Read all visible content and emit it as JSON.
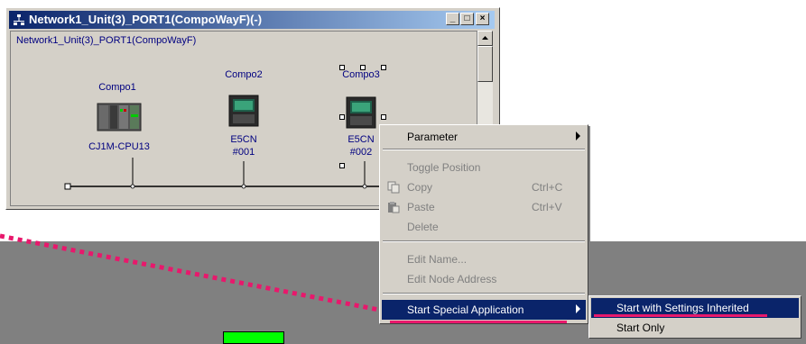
{
  "window": {
    "title": "Network1_Unit(3)_PORT1(CompoWayF)(-)",
    "network_label": "Network1_Unit(3)_PORT1(CompoWayF)",
    "min_glyph": "_",
    "max_glyph": "□",
    "close_glyph": "×"
  },
  "nodes": [
    {
      "name": "Compo1",
      "model": "CJ1M-CPU13",
      "address": ""
    },
    {
      "name": "Compo2",
      "model": "E5CN",
      "address": "#001"
    },
    {
      "name": "Compo3",
      "model": "E5CN",
      "address": "#002"
    }
  ],
  "context_menu": {
    "items": [
      {
        "label": "Parameter",
        "shortcut": "",
        "enabled": true,
        "submenu": true
      },
      {
        "label": "Toggle Position",
        "shortcut": "",
        "enabled": false
      },
      {
        "label": "Copy",
        "shortcut": "Ctrl+C",
        "enabled": false
      },
      {
        "label": "Paste",
        "shortcut": "Ctrl+V",
        "enabled": false
      },
      {
        "label": "Delete",
        "shortcut": "",
        "enabled": false
      },
      {
        "label": "Edit Name...",
        "shortcut": "",
        "enabled": false
      },
      {
        "label": "Edit Node Address",
        "shortcut": "",
        "enabled": false
      },
      {
        "label": "Start Special Application",
        "shortcut": "",
        "enabled": true,
        "submenu": true,
        "highlighted": true
      }
    ]
  },
  "sub_menu": {
    "items": [
      {
        "label": "Start with Settings Inherited",
        "highlighted": true
      },
      {
        "label": "Start Only",
        "highlighted": false
      }
    ]
  },
  "colors": {
    "highlight": "#0a246a",
    "annotation_pink": "#e8186c",
    "node_text": "#000080",
    "green_box": "#00ff00"
  }
}
